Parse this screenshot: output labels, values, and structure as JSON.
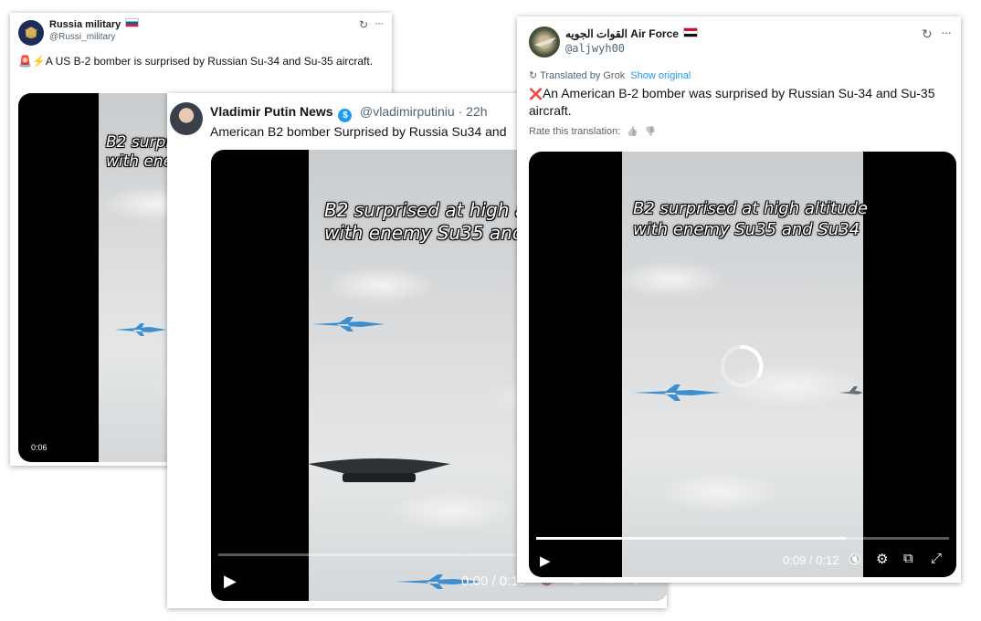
{
  "post1": {
    "name": "Russia military",
    "flag": "🇷🇺",
    "handle": "@Russi_military",
    "emoji": "🚨⚡",
    "text": "A US B-2 bomber is surprised by Russian Su-34 and Su-35 aircraft.",
    "video": {
      "overlay_line1": "B2 surpri",
      "overlay_line2": "with ene",
      "time": "0:06"
    }
  },
  "post2": {
    "name": "Vladimir Putin News",
    "handle": "@vladimirputiniu",
    "separator": "·",
    "time_ago": "22h",
    "text": "American B2 bomber Surprised by Russia Su34 and",
    "video": {
      "overlay_line1": "B2 surprised at high altitu",
      "overlay_line2": "with enemy Su35 and Su",
      "time": "0:00 / 0:15",
      "progress_fraction": 0.0
    }
  },
  "post3": {
    "name": "القوات الجويه Air Force",
    "flag": "🇸🇩",
    "handle": "@aljwyh00",
    "translated_by": "Translated by Grok",
    "show_original": "Show original",
    "emoji": "❌",
    "text": "An American B-2 bomber was surprised by Russian Su-34 and Su-35 aircraft.",
    "rate_translation": "Rate this translation:",
    "video": {
      "overlay_line1": "B2 surprised at high altitude",
      "overlay_line2": "with enemy Su35 and Su34",
      "time": "0:09 / 0:12",
      "progress_fraction": 0.75
    }
  },
  "icons": {
    "grok": "↻",
    "more": "···",
    "play": "▶",
    "mute": "🔇",
    "settings": "⚙",
    "pip": "⧉",
    "fullscreen": "⤢",
    "thumbs_up": "👍",
    "thumbs_down": "👎"
  },
  "colors": {
    "link": "#1d9bf0",
    "verified": "#1d9bf0",
    "secondary_text": "#536471"
  }
}
